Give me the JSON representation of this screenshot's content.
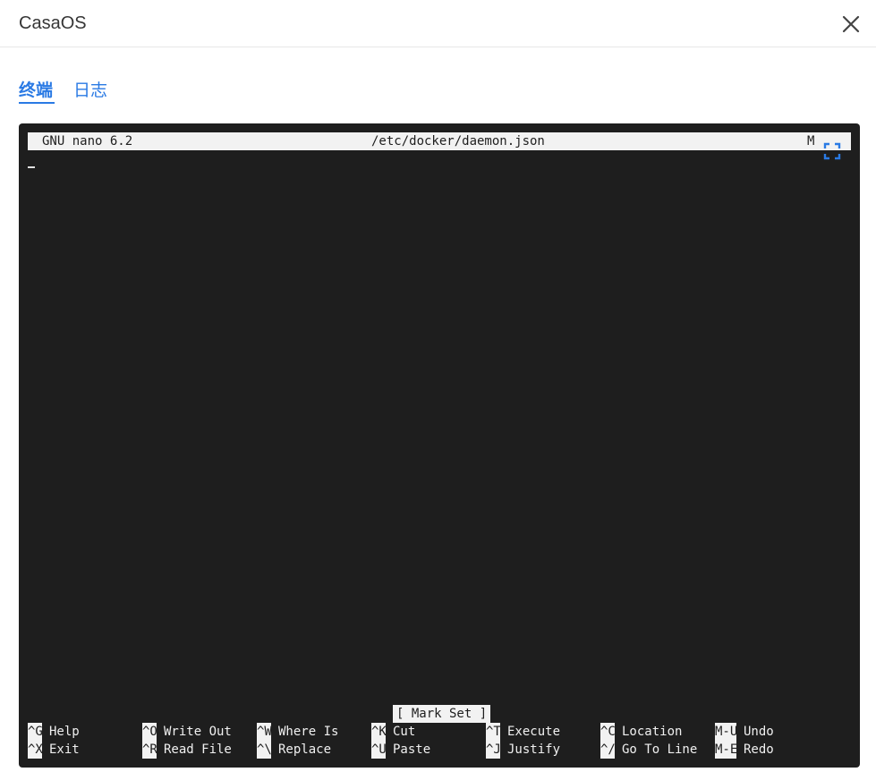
{
  "modal": {
    "title": "CasaOS"
  },
  "tabs": [
    {
      "label": "终端",
      "active": true
    },
    {
      "label": "日志",
      "active": false
    }
  ],
  "terminal": {
    "app": "GNU nano 6.2",
    "file": "/etc/docker/daemon.json",
    "modified_flag": "M",
    "status": "[ Mark Set ]",
    "shortcuts_row1": [
      {
        "key": "^G",
        "label": "Help"
      },
      {
        "key": "^O",
        "label": "Write Out"
      },
      {
        "key": "^W",
        "label": "Where Is"
      },
      {
        "key": "^K",
        "label": "Cut"
      },
      {
        "key": "^T",
        "label": "Execute"
      },
      {
        "key": "^C",
        "label": "Location"
      },
      {
        "key": "M-U",
        "label": "Undo"
      }
    ],
    "shortcuts_row2": [
      {
        "key": "^X",
        "label": "Exit"
      },
      {
        "key": "^R",
        "label": "Read File"
      },
      {
        "key": "^\\",
        "label": "Replace"
      },
      {
        "key": "^U",
        "label": "Paste"
      },
      {
        "key": "^J",
        "label": "Justify"
      },
      {
        "key": "^/",
        "label": "Go To Line"
      },
      {
        "key": "M-E",
        "label": "Redo"
      }
    ]
  },
  "colors": {
    "accent": "#2a7ae4",
    "terminal_bg": "#1e1e1e",
    "terminal_fg": "#f0f0f0"
  },
  "icons": {
    "close": "close-icon",
    "fullscreen": "fullscreen-icon"
  }
}
